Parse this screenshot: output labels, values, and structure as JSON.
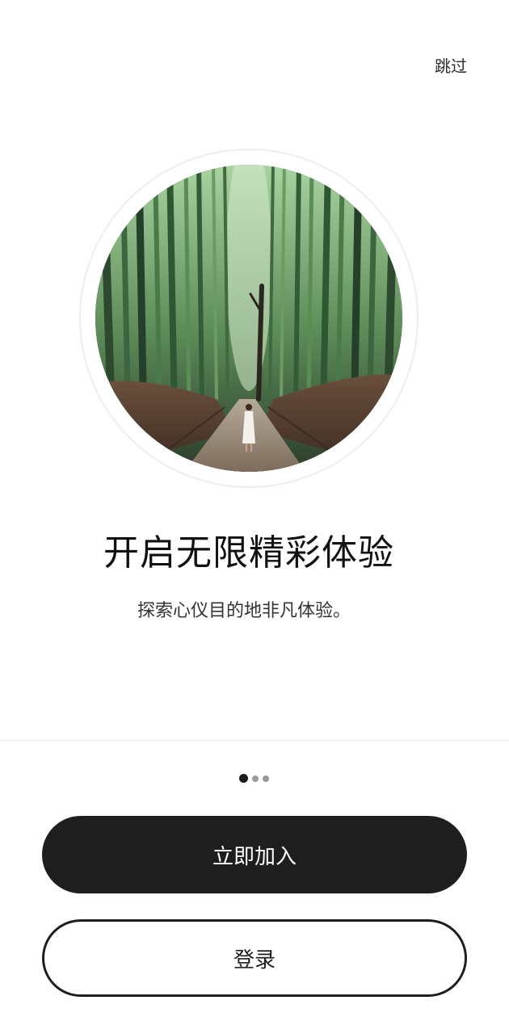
{
  "topbar": {
    "skip_label": "跳过"
  },
  "hero": {
    "image_description": "bamboo-forest-path-photo"
  },
  "content": {
    "title": "开启无限精彩体验",
    "subtitle": "探索心仪目的地非凡体验。"
  },
  "pager": {
    "total": 3,
    "active_index": 0
  },
  "actions": {
    "join_label": "立即加入",
    "login_label": "登录"
  },
  "colors": {
    "primary": "#1e1e1e",
    "background": "#ffffff",
    "dot_inactive": "#9a9a9a"
  }
}
